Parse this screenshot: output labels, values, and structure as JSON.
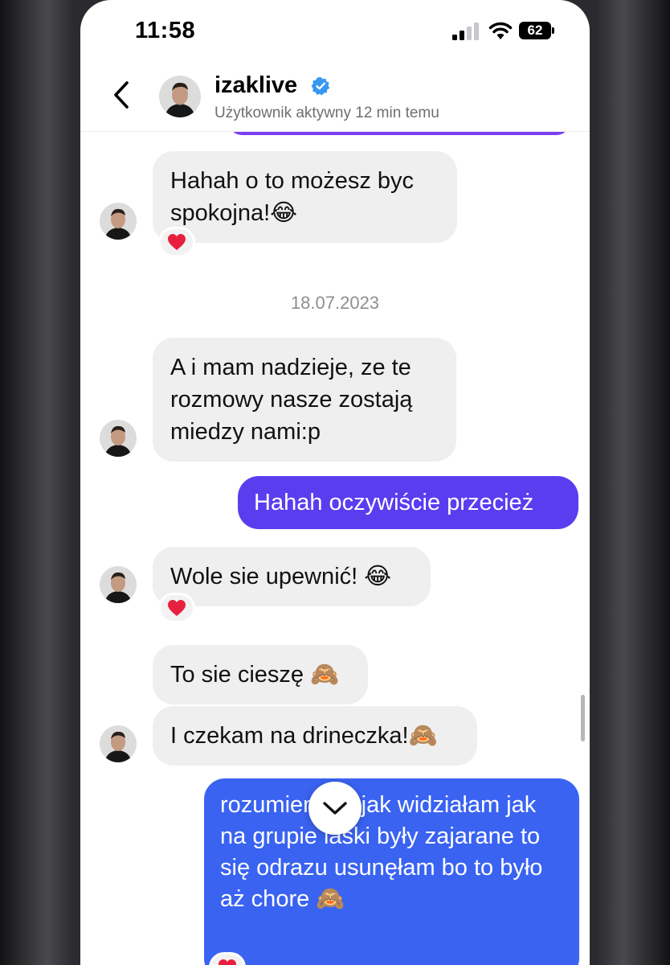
{
  "status_bar": {
    "time": "11:58",
    "battery": "62"
  },
  "header": {
    "username": "izaklive",
    "status": "Użytkownik aktywny 12 min temu",
    "back_icon": "chevron-left-icon",
    "verified_icon": "verified-badge-icon"
  },
  "messages": {
    "m1": "Hahah o to możesz byc spokojna!😂",
    "date": "18.07.2023",
    "m2": "A i mam nadzieje, ze te rozmowy nasze zostają miedzy nami:p",
    "m3": "Hahah oczywiście przecież",
    "m4": "Wole sie upewnić! 😂",
    "m5": "To sie cieszę 🙈",
    "m6": "I czekam na drineczka!🙈",
    "m7": "rozumiem bo jak widziałam jak na grupie laski były zajarane to się odrazu usunęłam bo to było aż chore 🙈"
  },
  "reaction_emoji": "heart",
  "colors": {
    "incoming_bubble": "#efefef",
    "outgoing_purple": "#5b3df0",
    "outgoing_blue": "#3a63f2",
    "verified": "#3897f0",
    "heart": "#e8203f"
  }
}
